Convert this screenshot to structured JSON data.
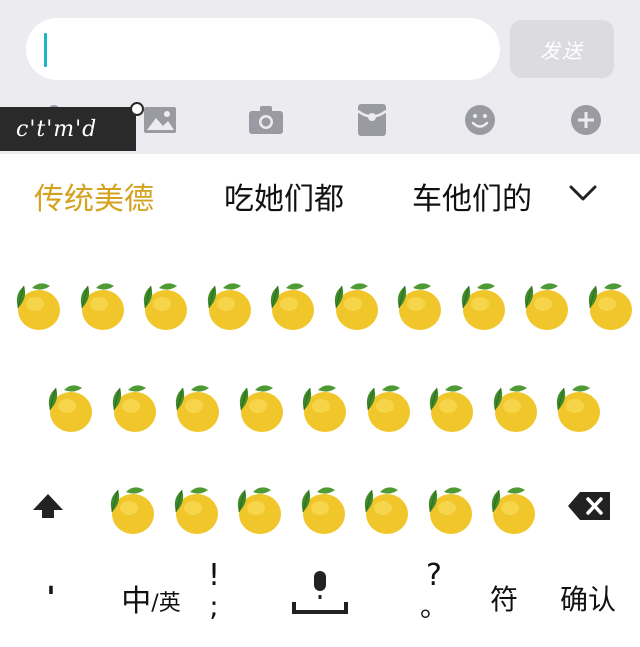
{
  "input": {
    "value": "",
    "send_label": "发送"
  },
  "watermark": {
    "text": "c't'm'd"
  },
  "toolbar": {
    "icons": [
      "mic-icon",
      "image-icon",
      "camera-icon",
      "red-packet-icon",
      "emoji-icon",
      "plus-icon"
    ]
  },
  "candidates": [
    "传统美德",
    "吃她们都",
    "车他们的"
  ],
  "keyboard": {
    "row1_count": 10,
    "row2_count": 9,
    "row3_count": 7,
    "key_glyph": "lemon-emoji"
  },
  "bottom_row": {
    "comma": "'",
    "lang_main": "中",
    "lang_sub": "/英",
    "punct_top": "!",
    "punct_bottom": ";",
    "question_top": "?",
    "question_bottom": "。",
    "symbol": "符",
    "confirm": "确认"
  },
  "colors": {
    "accent_selected": "#d4a21f",
    "caret": "#1fb5c9",
    "toolbar_bg": "#ececf0"
  }
}
